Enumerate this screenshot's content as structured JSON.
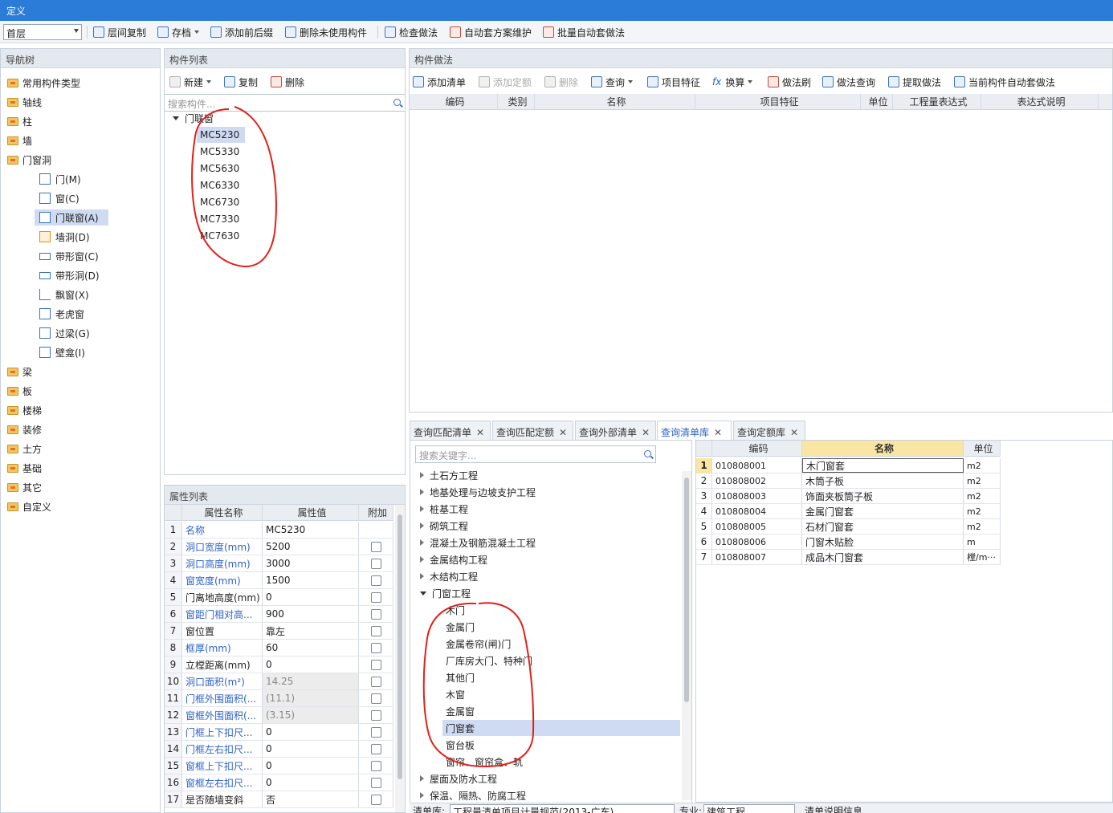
{
  "window": {
    "title": "定义"
  },
  "toolbar": {
    "floor": "首层",
    "buttons": [
      "层间复制",
      "存档",
      "添加前后缀",
      "删除未使用构件",
      "检查做法",
      "自动套方案维护",
      "批量自动套做法"
    ]
  },
  "nav": {
    "header": "导航树",
    "top_items": [
      "常用构件类型",
      "轴线",
      "柱",
      "墙",
      "门窗洞"
    ],
    "sub_items": [
      "门(M)",
      "窗(C)",
      "门联窗(A)",
      "墙洞(D)",
      "带形窗(C)",
      "带形洞(D)",
      "飘窗(X)",
      "老虎窗",
      "过梁(G)",
      "壁龛(I)"
    ],
    "bottom_items": [
      "梁",
      "板",
      "楼梯",
      "装修",
      "土方",
      "基础",
      "其它",
      "自定义"
    ]
  },
  "component_list": {
    "header": "构件列表",
    "buttons": [
      "新建",
      "复制",
      "删除"
    ],
    "search_placeholder": "搜索构件...",
    "root": "门联窗",
    "items": [
      "MC5230",
      "MC5330",
      "MC5630",
      "MC6330",
      "MC6730",
      "MC7330",
      "MC7630"
    ]
  },
  "props": {
    "header": "属性列表",
    "columns": [
      "属性名称",
      "属性值",
      "附加"
    ],
    "rows": [
      {
        "n": "1",
        "name": "名称",
        "value": "MC5230"
      },
      {
        "n": "2",
        "name": "洞口宽度(mm)",
        "value": "5200"
      },
      {
        "n": "3",
        "name": "洞口高度(mm)",
        "value": "3000"
      },
      {
        "n": "4",
        "name": "窗宽度(mm)",
        "value": "1500"
      },
      {
        "n": "5",
        "name": "门离地高度(mm)",
        "value": "0"
      },
      {
        "n": "6",
        "name": "窗距门相对高...",
        "value": "900"
      },
      {
        "n": "7",
        "name": "窗位置",
        "value": "靠左"
      },
      {
        "n": "8",
        "name": "框厚(mm)",
        "value": "60"
      },
      {
        "n": "9",
        "name": "立樘距离(mm)",
        "value": "0"
      },
      {
        "n": "10",
        "name": "洞口面积(m²)",
        "value": "14.25"
      },
      {
        "n": "11",
        "name": "门框外围面积(...",
        "value": "(11.1)"
      },
      {
        "n": "12",
        "name": "窗框外围面积(...",
        "value": "(3.15)"
      },
      {
        "n": "13",
        "name": "门框上下扣尺...",
        "value": "0"
      },
      {
        "n": "14",
        "name": "门框左右扣尺...",
        "value": "0"
      },
      {
        "n": "15",
        "name": "窗框上下扣尺...",
        "value": "0"
      },
      {
        "n": "16",
        "name": "窗框左右扣尺...",
        "value": "0"
      },
      {
        "n": "17",
        "name": "是否随墙变斜",
        "value": "否"
      }
    ]
  },
  "method": {
    "header": "构件做法",
    "buttons": [
      "添加清单",
      "添加定额",
      "删除",
      "查询",
      "项目特征",
      "换算",
      "做法刷",
      "做法查询",
      "提取做法",
      "当前构件自动套做法"
    ],
    "columns": [
      "编码",
      "类别",
      "名称",
      "项目特征",
      "单位",
      "工程量表达式",
      "表达式说明"
    ]
  },
  "query": {
    "tabs": [
      "查询匹配清单",
      "查询匹配定额",
      "查询外部清单",
      "查询清单库",
      "查询定额库"
    ],
    "search_placeholder": "搜索关键字...",
    "tree_before": [
      "土石方工程",
      "地基处理与边坡支护工程",
      "桩基工程",
      "砌筑工程",
      "混凝土及钢筋混凝土工程",
      "金属结构工程",
      "木结构工程"
    ],
    "open_node": "门窗工程",
    "children": [
      "木门",
      "金属门",
      "金属卷帘(闸)门",
      "厂库房大门、特种门",
      "其他门",
      "木窗",
      "金属窗",
      "门窗套",
      "窗台板",
      "窗帘、窗帘盒、轨"
    ],
    "tree_after": [
      "屋面及防水工程",
      "保温、隔热、防腐工程"
    ],
    "footer": {
      "lib_label": "清单库:",
      "lib_value": "工程量清单项目计量规范(2013-广东)",
      "major_label": "专业:",
      "major_value": "建筑工程",
      "desc_label": "清单说明信息"
    }
  },
  "result": {
    "columns": [
      "编码",
      "名称",
      "单位"
    ],
    "rows": [
      {
        "n": "1",
        "code": "010808001",
        "name": "木门窗套",
        "unit": "m2"
      },
      {
        "n": "2",
        "code": "010808002",
        "name": "木筒子板",
        "unit": "m2"
      },
      {
        "n": "3",
        "code": "010808003",
        "name": "饰面夹板筒子板",
        "unit": "m2"
      },
      {
        "n": "4",
        "code": "010808004",
        "name": "金属门窗套",
        "unit": "m2"
      },
      {
        "n": "5",
        "code": "010808005",
        "name": "石材门窗套",
        "unit": "m2"
      },
      {
        "n": "6",
        "code": "010808006",
        "name": "门窗木贴脸",
        "unit": "m"
      },
      {
        "n": "7",
        "code": "010808007",
        "name": "成品木门窗套",
        "unit": "樘/m···"
      }
    ]
  },
  "colors": {
    "titlebar": "#2b7bd8",
    "annotation": "#e0201b",
    "selection": "#cfdbf2",
    "link": "#2d62c7"
  }
}
